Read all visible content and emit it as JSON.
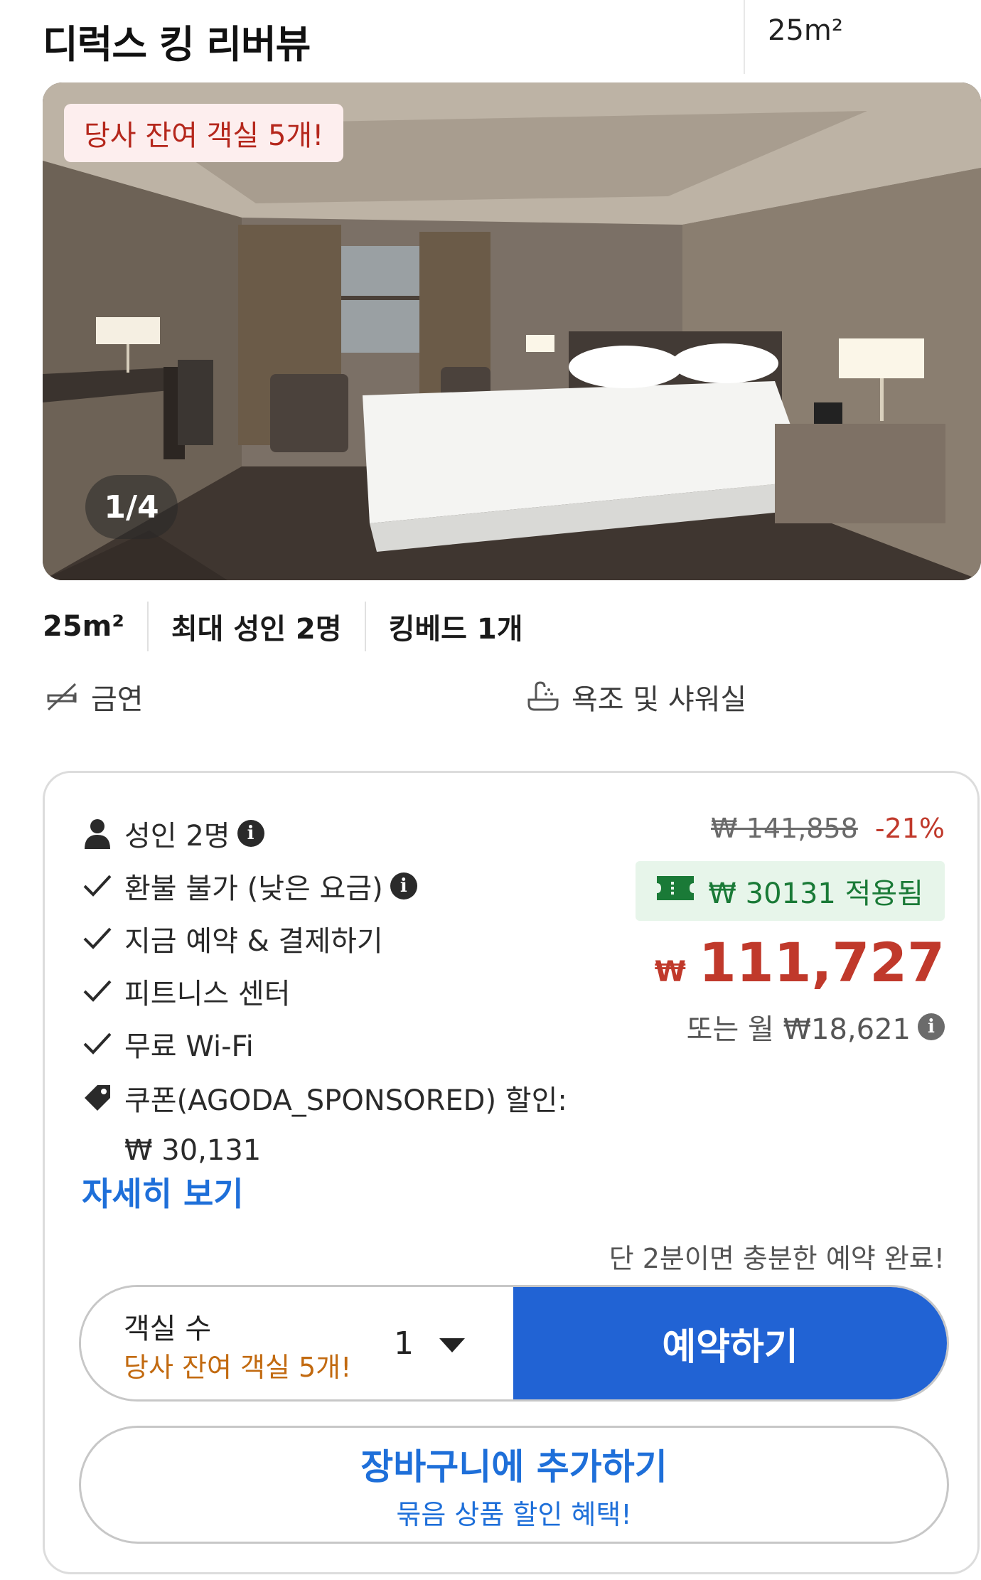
{
  "header": {
    "room_name": "디럭스 킹 리버뷰",
    "room_size": "25m²"
  },
  "photo": {
    "availability_badge": "당사 잔여 객실 5개!",
    "counter": "1/4"
  },
  "specs": [
    "25m²",
    "최대 성인 2명",
    "킹베드 1개"
  ],
  "amenities": [
    {
      "icon": "no-smoking-icon",
      "label": "금연"
    },
    {
      "icon": "bath-shower-icon",
      "label": "욕조 및 샤워실"
    }
  ],
  "offer": {
    "occupancy": "성인 2명",
    "features": [
      "환불 불가 (낮은 요금)",
      "지금 예약 & 결제하기",
      "피트니스 센터",
      "무료 Wi-Fi"
    ],
    "coupon_line": "쿠폰(AGODA_SPONSORED) 할인:",
    "coupon_amount": "₩ 30,131",
    "details_link": "자세히 보기",
    "original_price": "₩ 141,858",
    "discount": "-21%",
    "coupon_applied": "₩ 30131 적용됨",
    "currency": "₩",
    "final_price": "111,727",
    "monthly": "또는 월 ₩18,621",
    "quick_note": "단 2분이면 충분한 예약 완료!",
    "rooms_label": "객실 수",
    "rooms_warning": "당사 잔여 객실 5개!",
    "rooms_value": "1",
    "book_button": "예약하기",
    "cart_button": "장바구니에 추가하기",
    "cart_sub": "묶음 상품 할인 혜택!"
  },
  "colors": {
    "accent_blue": "#2163d4",
    "link_blue": "#1e6fd9",
    "price_red": "#c0392b",
    "coupon_green": "#1a7a37",
    "warning_orange": "#c26a10"
  }
}
